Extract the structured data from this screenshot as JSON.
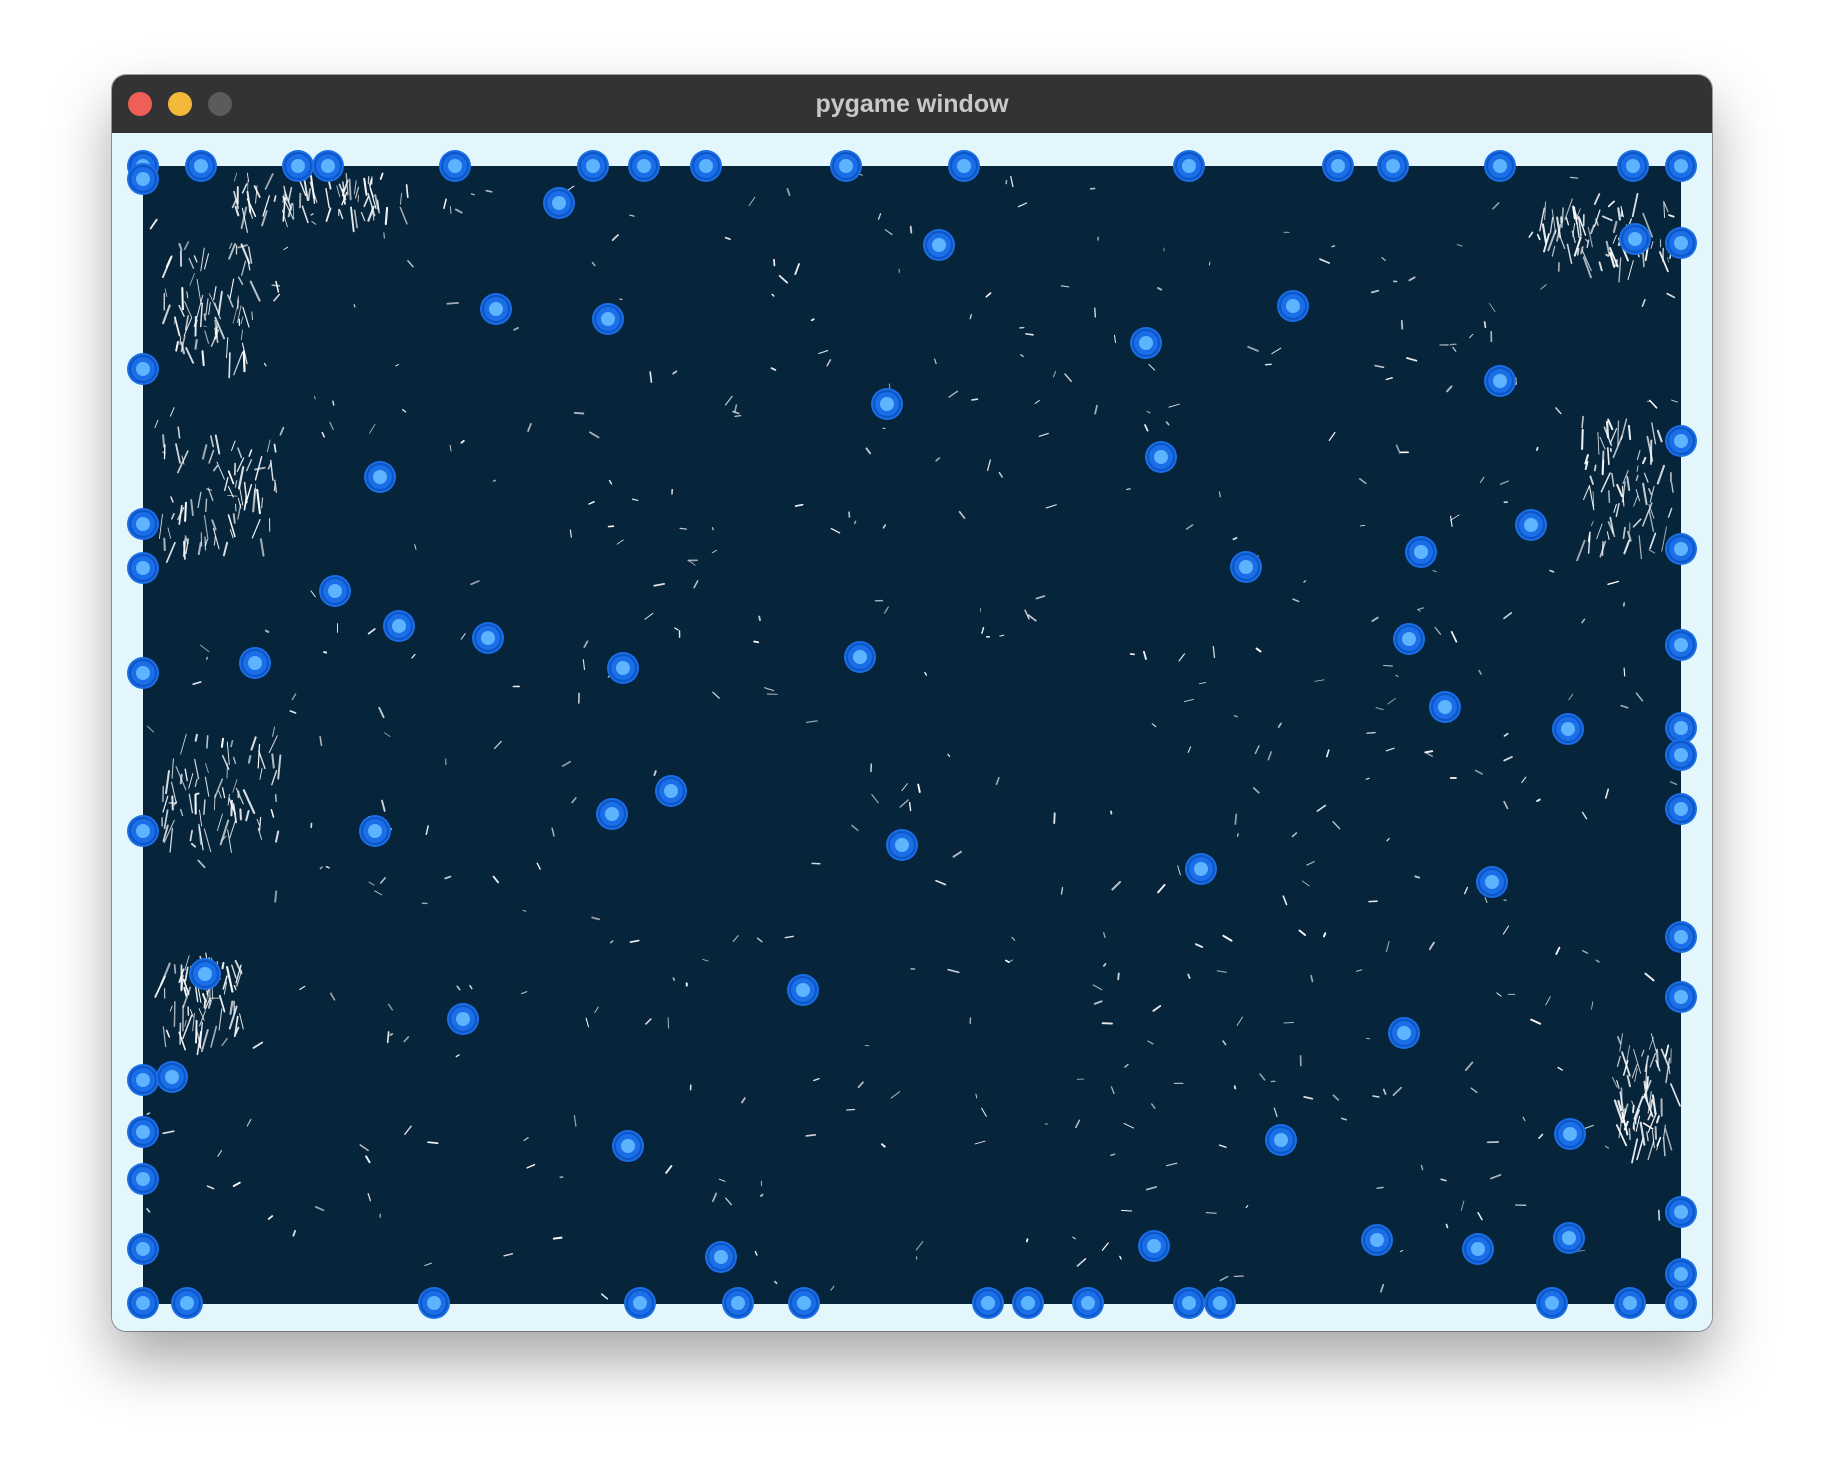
{
  "window": {
    "title": "pygame window",
    "buttons": {
      "close": "close-button",
      "minimize": "minimize-button",
      "zoom": "zoom-button"
    }
  },
  "colors": {
    "titlebar": "#333333",
    "title_text": "#c8c8c8",
    "border": "#e2f6fc",
    "field": "#06243a",
    "node_outer": "#1a6ee8",
    "node_inner": "#5fb4ff",
    "streak": "#ffffff"
  }
}
